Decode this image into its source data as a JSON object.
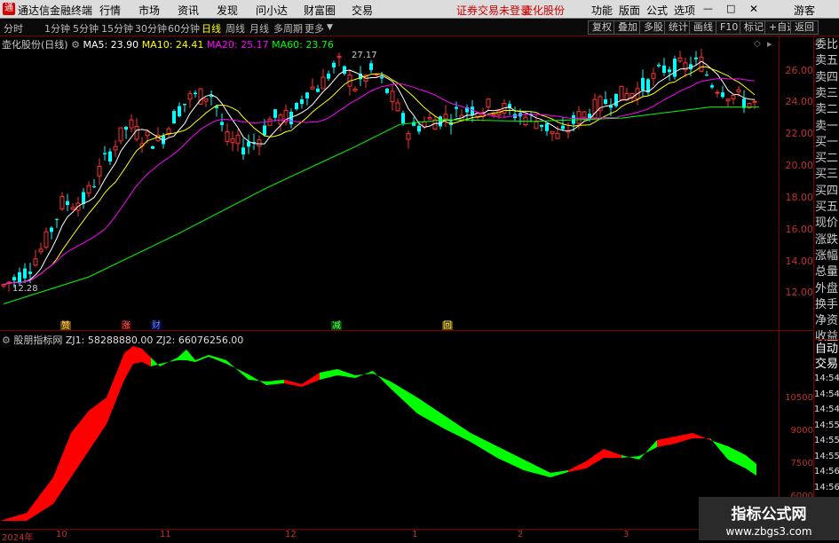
{
  "menu": {
    "app_name": "通达信金融终端",
    "items": [
      "行情",
      "市场",
      "资讯",
      "发现",
      "问小达",
      "财富圈",
      "交易"
    ],
    "notice": "证券交易未登录",
    "stock_link": "壶化股份",
    "right_items": [
      "功能",
      "版面",
      "公式",
      "选项"
    ],
    "guest": "游客"
  },
  "periods": [
    "分时",
    "1分钟",
    "5分钟",
    "15分钟",
    "30分钟",
    "60分钟",
    "日线",
    "周线",
    "月线",
    "多周期",
    "更多"
  ],
  "active_period": "日线",
  "toolbar": [
    "复权",
    "叠加",
    "多股",
    "统计",
    "画线",
    "F10",
    "标记",
    "+自选",
    "返回"
  ],
  "main_chart": {
    "title": "壶化股份(日线)",
    "ma5": "MA5: 23.90",
    "ma10": "MA10: 24.41",
    "ma20": "MA20: 25.17",
    "ma60": "MA60: 23.76",
    "high_label": "27.17",
    "low_label": "12.28",
    "y_ticks": [
      "26.00",
      "24.00",
      "22.00",
      "20.00",
      "18.00",
      "16.00",
      "14.00",
      "12.00"
    ],
    "markers": [
      "赞",
      "涨",
      "财",
      "减",
      "回"
    ]
  },
  "indicator": {
    "title": "股朋指标网",
    "zj1": "ZJ1: 58288880.00",
    "zj2": "ZJ2: 66076256.00",
    "y_ticks": [
      "10500",
      "9000",
      "7500",
      "6000"
    ]
  },
  "x_axis": [
    "2024年",
    "10",
    "11",
    "12",
    "1",
    "2",
    "3"
  ],
  "side_panel": [
    "委比",
    "卖五",
    "卖四",
    "卖三",
    "卖二",
    "卖一",
    "买一",
    "买二",
    "买三",
    "买四",
    "买五",
    "现价",
    "涨跌",
    "涨幅",
    "总量",
    "外盘",
    "换手",
    "净资",
    "收益"
  ],
  "side_panel2": [
    "自动",
    "交易"
  ],
  "side_times": [
    "14:54",
    "14:54",
    "14:54",
    "14:55",
    "14:55",
    "14:55",
    "14:56",
    "14:56",
    "14:56"
  ],
  "watermark": {
    "line1": "指标公式网",
    "line2": "www.zbgs3.com"
  },
  "colors": {
    "up": "#ff3030",
    "down": "#00ffff",
    "ma5": "#ffffff",
    "ma10": "#ffff00",
    "ma20": "#ff00ff",
    "ma60": "#00ff00",
    "fill_up": "#ff0000",
    "fill_down": "#00ff00"
  }
}
